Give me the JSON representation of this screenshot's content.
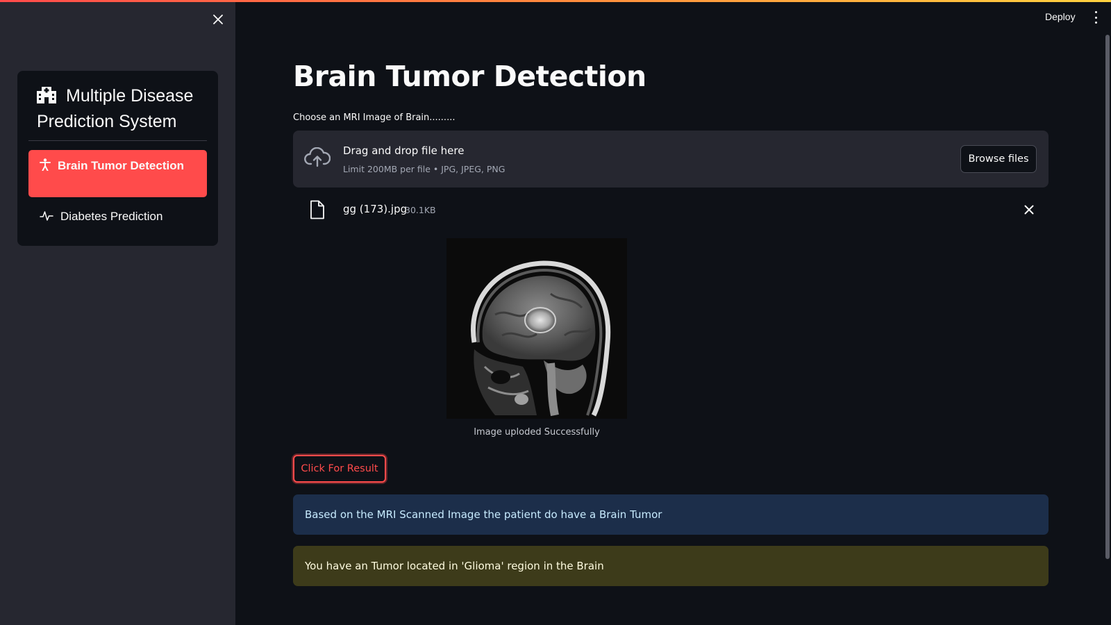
{
  "sidebar": {
    "menu_title": "Multiple Disease Prediction System",
    "items": [
      {
        "label": "Brain Tumor Detection",
        "icon": "person-icon",
        "active": true
      },
      {
        "label": "Diabetes Prediction",
        "icon": "activity-icon",
        "active": false
      }
    ]
  },
  "header": {
    "deploy_label": "Deploy"
  },
  "main": {
    "title": "Brain Tumor Detection",
    "uploader": {
      "label": "Choose an MRI Image of Brain.........",
      "drop_text": "Drag and drop file here",
      "limit_text": "Limit 200MB per file • JPG, JPEG, PNG",
      "browse_label": "Browse files"
    },
    "file": {
      "name": "gg (173).jpg",
      "size": "30.1KB"
    },
    "image_caption": "Image uploded Successfully",
    "result_button": "Click For Result",
    "info_message": "Based on the MRI Scanned Image the patient do have a Brain Tumor",
    "warning_message": "You have an Tumor located in 'Glioma' region in the Brain"
  },
  "colors": {
    "accent": "#ff4b4b",
    "background": "#0e1117",
    "sidebar": "#262730",
    "info_bg": "#1c2e4a",
    "warning_bg": "#3d3b1a"
  }
}
